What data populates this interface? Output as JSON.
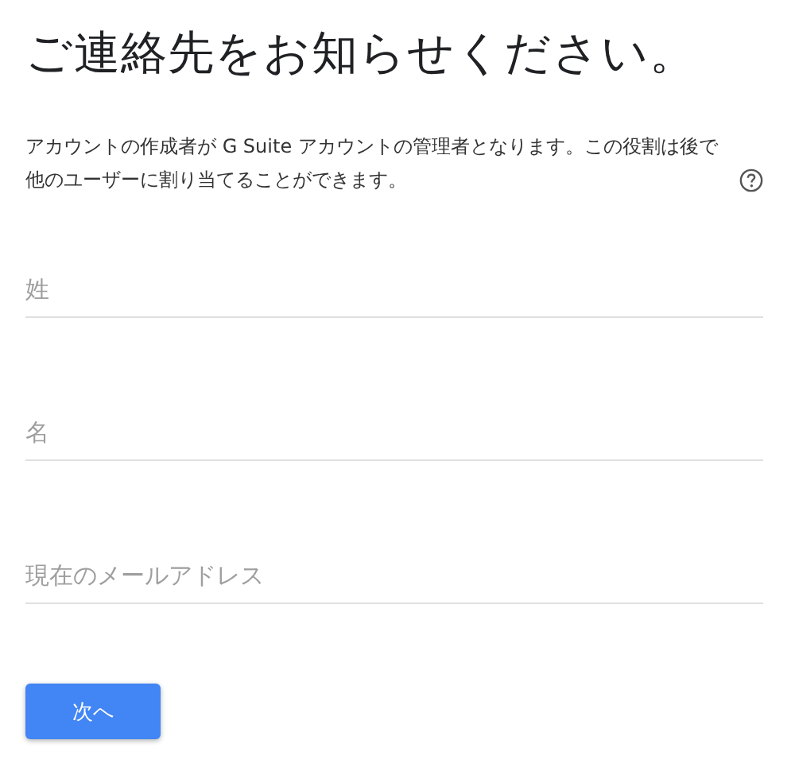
{
  "title": "ご連絡先をお知らせください。",
  "description": "アカウントの作成者が G Suite アカウントの管理者となります。この役割は後で他のユーザーに割り当てることができます。",
  "fields": [
    {
      "placeholder": "姓"
    },
    {
      "placeholder": "名"
    },
    {
      "placeholder": "現在のメールアドレス"
    }
  ],
  "button": "次へ"
}
